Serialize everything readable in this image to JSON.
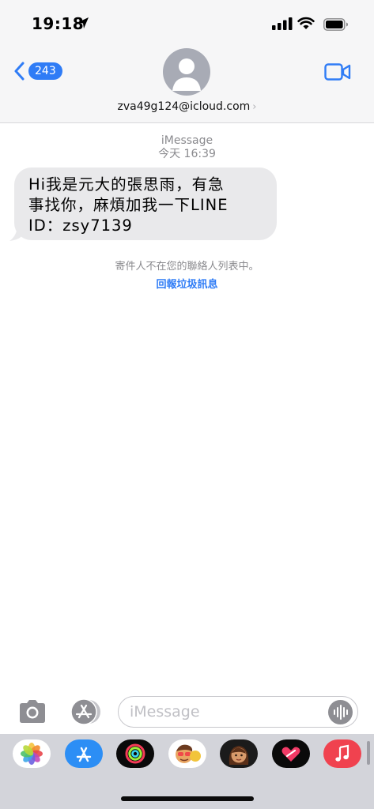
{
  "status_bar": {
    "time": "19:18"
  },
  "header": {
    "back_count": "243",
    "contact": "zva49g124@icloud.com",
    "chevron": "›"
  },
  "conversation": {
    "service": "iMessage",
    "timestamp": "今天 16:39",
    "message_lines": [
      "Hi我是元大的張思雨，有急",
      "事找你，麻煩加我一下LINE",
      "ID：zsy7139"
    ],
    "notice": "寄件人不在您的聯絡人列表中。",
    "report_link": "回報垃圾訊息"
  },
  "input_bar": {
    "placeholder": "iMessage"
  },
  "app_strip": {
    "apps": [
      "photos-icon",
      "app-store-icon",
      "activity-icon",
      "memoji-icon",
      "memoji-2-icon",
      "digital-touch-icon",
      "music-icon"
    ]
  },
  "colors": {
    "accent": "#2f7cf6",
    "bubble": "#e9e9eb",
    "music": "#f0424f"
  }
}
